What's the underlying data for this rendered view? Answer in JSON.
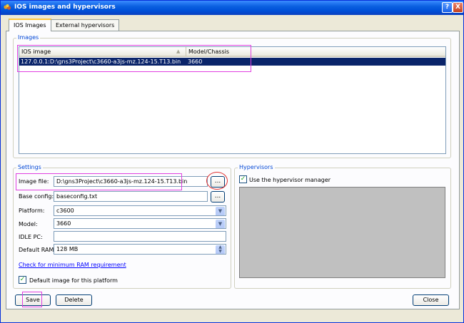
{
  "window": {
    "title": "IOS images and hypervisors",
    "help_label": "?",
    "close_label": "X"
  },
  "tabs": [
    {
      "label": "IOS Images",
      "active": true
    },
    {
      "label": "External hypervisors",
      "active": false
    }
  ],
  "images_group": {
    "label": "Images",
    "columns": [
      "IOS image",
      "Model/Chassis"
    ],
    "rows": [
      {
        "image": "127.0.0.1:D:\\gns3Project\\c3660-a3js-mz.124-15.T13.bin",
        "model": "3660",
        "selected": true
      }
    ]
  },
  "settings": {
    "label": "Settings",
    "image_file_label": "Image file:",
    "image_file_value": "D:\\gns3Project\\c3660-a3js-mz.124-15.T13.bin",
    "base_config_label": "Base config:",
    "base_config_value": "baseconfig.txt",
    "browse_label": "...",
    "platform_label": "Platform:",
    "platform_value": "c3600",
    "model_label": "Model:",
    "model_value": "3660",
    "idle_pc_label": "IDLE PC:",
    "idle_pc_value": "",
    "default_ram_label": "Default RAM:",
    "default_ram_value": "128 MB",
    "ram_link": "Check for minimum RAM requirement",
    "default_image_label": "Default image for this platform",
    "default_image_checked": true
  },
  "hypervisors": {
    "label": "Hypervisors",
    "use_manager_label": "Use the hypervisor manager",
    "use_manager_checked": true
  },
  "buttons": {
    "save": "Save",
    "delete": "Delete",
    "close": "Close"
  },
  "colors": {
    "titlebar": "#0a5fe0",
    "selection": "#0a246a",
    "group_label": "#0046d5",
    "highlight_box": "#e040e0",
    "highlight_circle": "#e03030"
  }
}
